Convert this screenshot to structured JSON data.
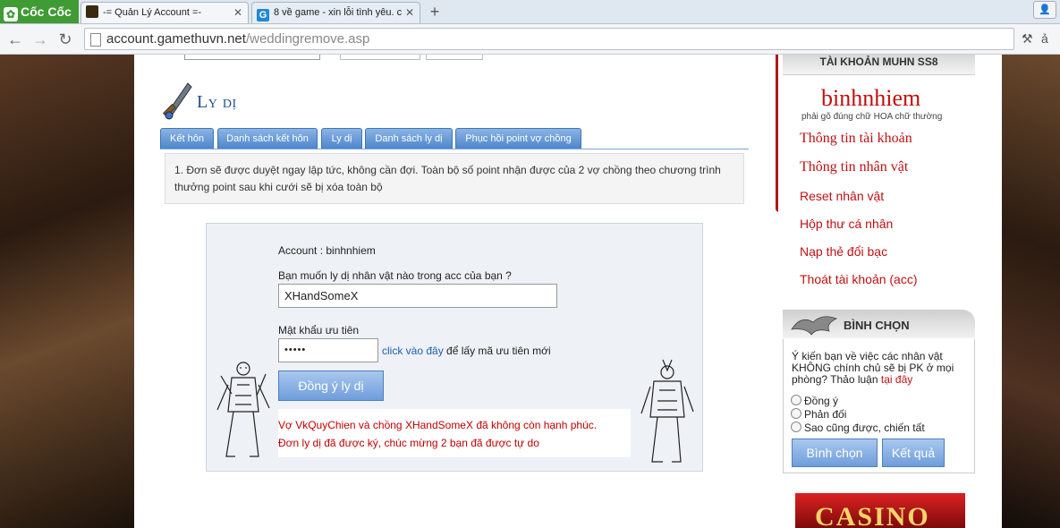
{
  "browser": {
    "brand": "Cốc Cốc",
    "tabs": [
      {
        "title": "-= Quản Lý Account =-"
      },
      {
        "title": "8 về game - xin lỗi tình yêu. c"
      }
    ],
    "url": {
      "host": "account.gamethuvn.net",
      "path": "/weddingremove.asp"
    }
  },
  "page": {
    "title": "Ly dị",
    "tabs": [
      "Kết hôn",
      "Danh sách kết hôn",
      "Ly dị",
      "Danh sách ly dị",
      "Phục hồi point vợ chồng"
    ],
    "notice": "1. Đơn sẽ được duyệt ngay lập tức, không cần đợi. Toàn bộ số point nhận được của 2 vợ chồng theo chương trình thưởng point sau khi cưới sẽ bị xóa toàn bộ",
    "form": {
      "account_label": "Account : binhnhiem",
      "question": "Bạn muốn ly dị nhân vật nào trong acc của bạn ?",
      "character_value": "XHandSomeX",
      "password_label": "Mật khẩu ưu tiên",
      "password_value": "•••••",
      "link_text": "click vào đây",
      "link_suffix": "để lấy mã ưu tiên mới",
      "submit_label": "Đồng ý ly dị",
      "message_line1": "Vợ VkQuyChien và chồng XHandSomeX đã không còn hạnh phúc.",
      "message_line2": "Đơn ly dị đã được ký, chúc mừng 2 bạn đã được tự do"
    }
  },
  "sidebar": {
    "header": "TÀI KHOẢN MUHN SS8",
    "username": "binhnhiem",
    "hint": "phải gõ đúng chữ HOA chữ thường",
    "menu_big": [
      "Thông tin tài khoản",
      "Thông tin nhân vật"
    ],
    "menu": [
      "Reset nhân vật",
      "Hộp thư cá nhân",
      "Nạp thẻ đổi bạc",
      "Thoát tài khoản (acc)"
    ],
    "poll": {
      "header": "BÌNH CHỌN",
      "question": "Ý kiến bạn về việc các nhân vật KHÔNG chính chủ sẽ bị PK ở mọi phòng? Thảo luận",
      "question_link": "tại đây",
      "options": [
        "Đồng ý",
        "Phản đối",
        "Sao cũng được, chiến tất"
      ],
      "vote_button": "Bình chọn",
      "result_button": "Kết quả"
    },
    "banner_text": "CASINO"
  },
  "colors": {
    "brand_green": "#3f9b33",
    "accent_blue": "#4d86cc",
    "menu_red": "#c01010"
  }
}
